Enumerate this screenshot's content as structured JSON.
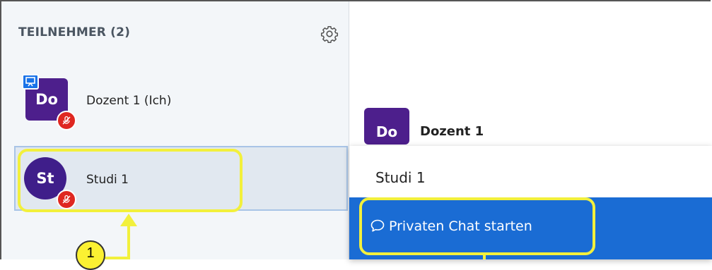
{
  "sidebar": {
    "header": "TEILNEHMER (2)",
    "users": [
      {
        "initials": "Do",
        "name": "Dozent 1 (Ich)",
        "presenter": true,
        "muted": true
      },
      {
        "initials": "St",
        "name": "Studi 1",
        "presenter": false,
        "muted": true
      }
    ]
  },
  "chat": {
    "sender_initials": "Do",
    "sender_name": "Dozent 1"
  },
  "popup": {
    "title": "Studi 1",
    "action_label": "Privaten Chat starten"
  },
  "annotations": {
    "step_number": "1",
    "highlight_color": "#f2f03c"
  },
  "colors": {
    "avatar": "#4d1f8c",
    "muted": "#df2721",
    "action": "#1a6cd4",
    "presenter": "#1a73e8"
  }
}
